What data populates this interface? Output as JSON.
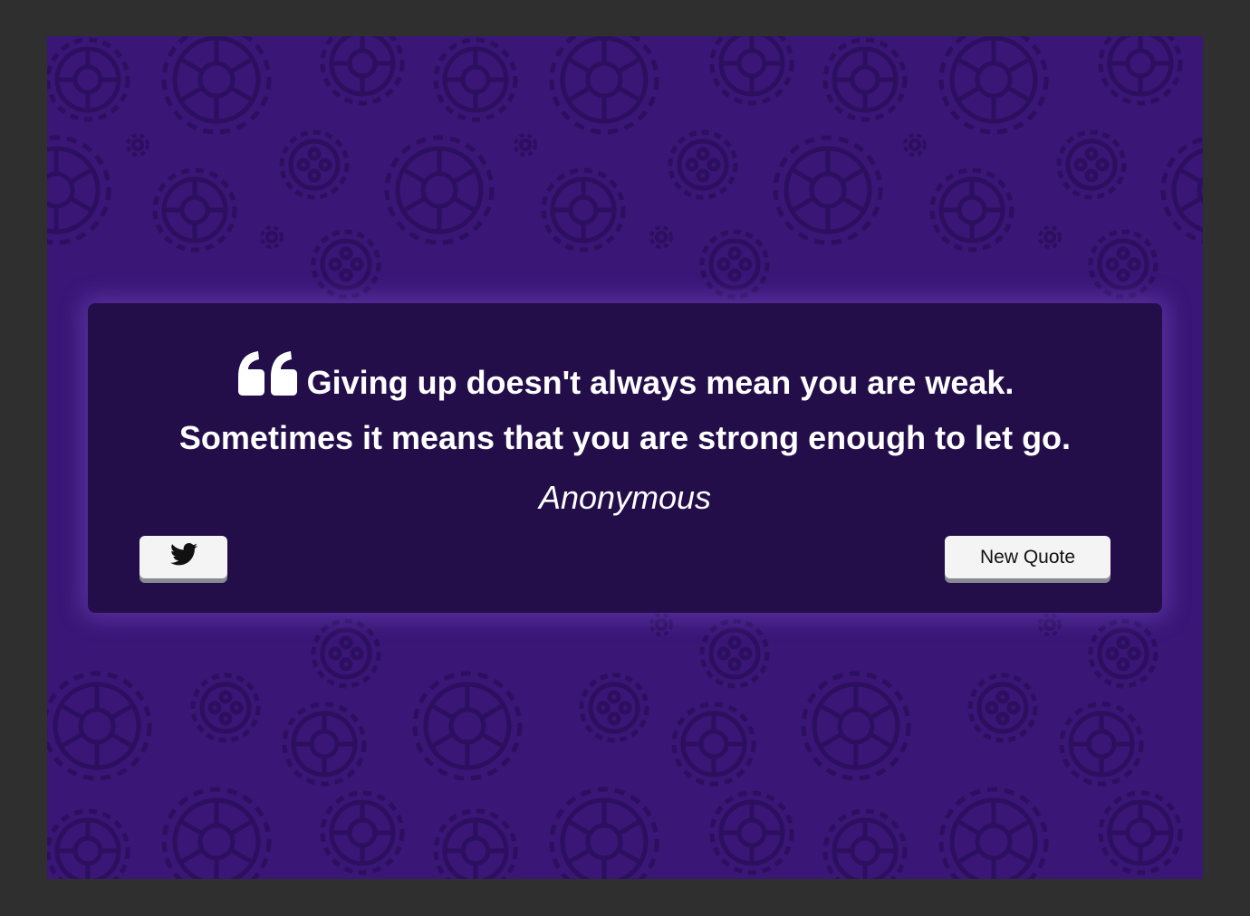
{
  "quote": {
    "text_line1": "Giving up doesn't always mean you are weak.",
    "text_line2": "Sometimes it means that you are strong enough to let go.",
    "author": "Anonymous"
  },
  "buttons": {
    "tweet_icon": "twitter-icon",
    "new_quote_label": "New Quote"
  },
  "colors": {
    "page_background": "#2f2f2f",
    "stage_background": "#3a1677",
    "gear_pattern": "#2c0f5e",
    "card_background": "#230e4a",
    "text": "#ffffff",
    "button_background": "#f4f4f4"
  }
}
